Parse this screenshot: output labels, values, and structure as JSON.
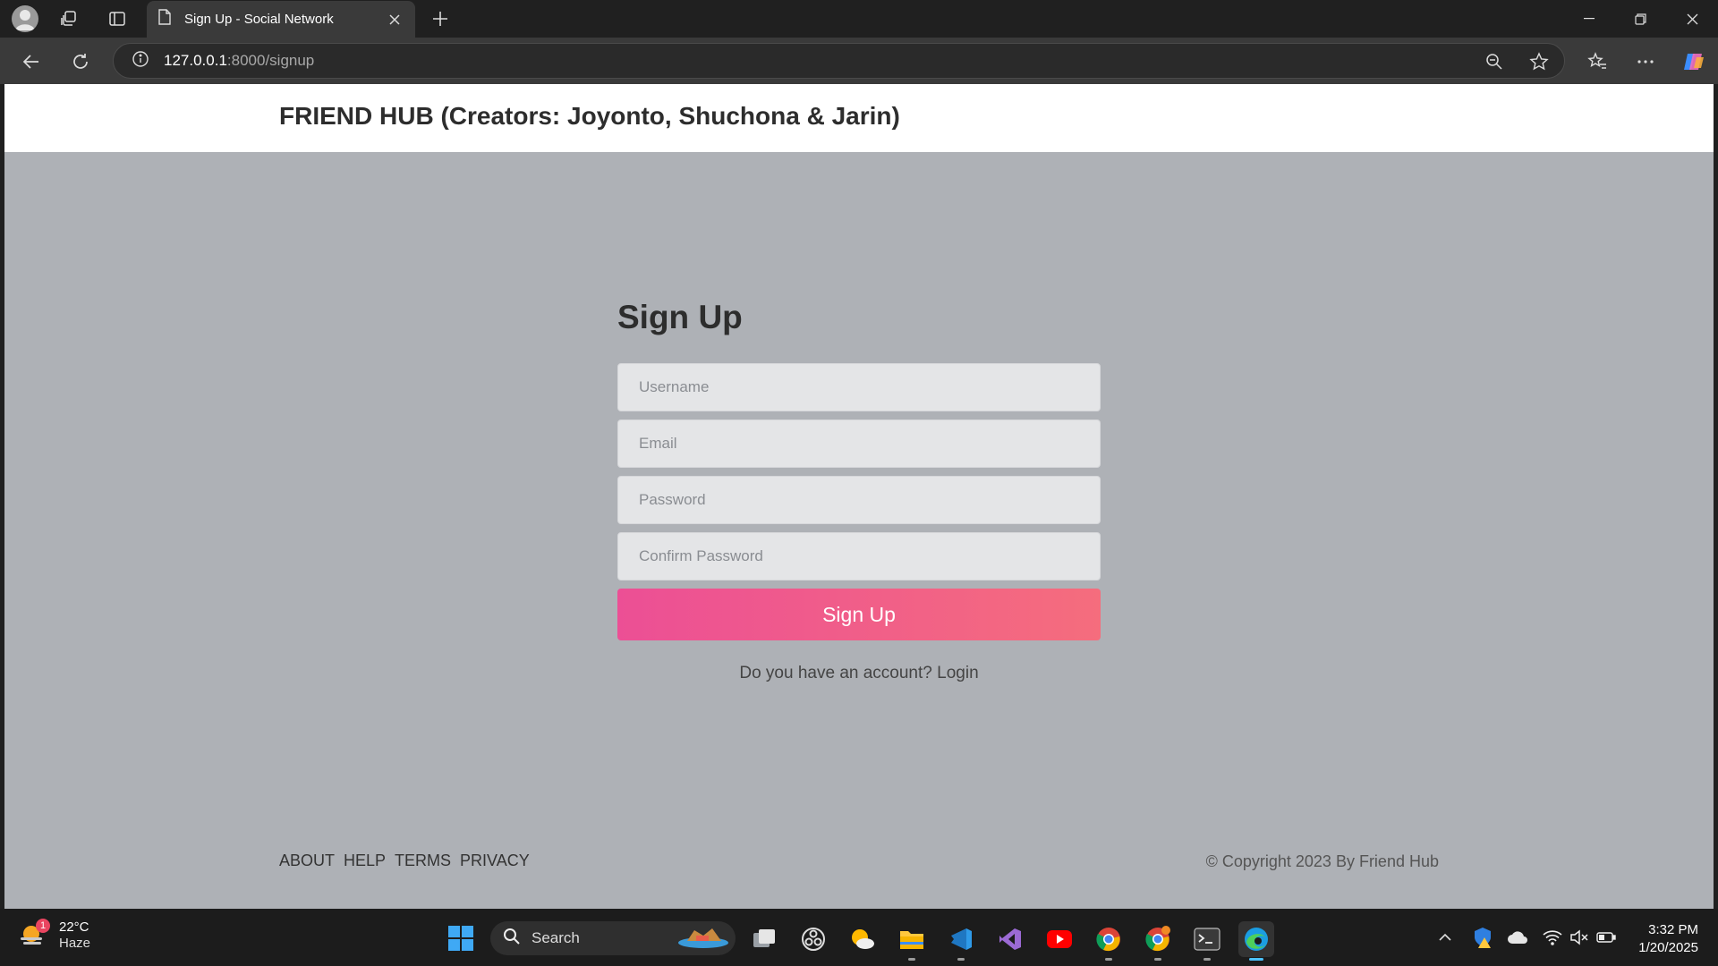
{
  "browser": {
    "tab_title": "Sign Up - Social Network",
    "url_host": "127.0.0.1",
    "url_path": ":8000/signup"
  },
  "page": {
    "site_title": "FRIEND HUB (Creators: Joyonto, Shuchona & Jarin)",
    "form_heading": "Sign Up",
    "fields": {
      "username_placeholder": "Username",
      "email_placeholder": "Email",
      "password_placeholder": "Password",
      "confirm_password_placeholder": "Confirm Password"
    },
    "submit_label": "Sign Up",
    "login_prompt": "Do you have an account?",
    "login_link": "Login",
    "footer_links": [
      "ABOUT",
      "HELP",
      "TERMS",
      "PRIVACY"
    ],
    "copyright": "© Copyright 2023 By Friend Hub"
  },
  "taskbar": {
    "weather_temp": "22°C",
    "weather_condition": "Haze",
    "weather_badge": "1",
    "search_label": "Search",
    "time": "3:32 PM",
    "date": "1/20/2025"
  },
  "colors": {
    "button_gradient_start": "#ec4f95",
    "button_gradient_end": "#f56d7d",
    "page_background": "#aeb1b6",
    "header_background": "#ffffff"
  }
}
